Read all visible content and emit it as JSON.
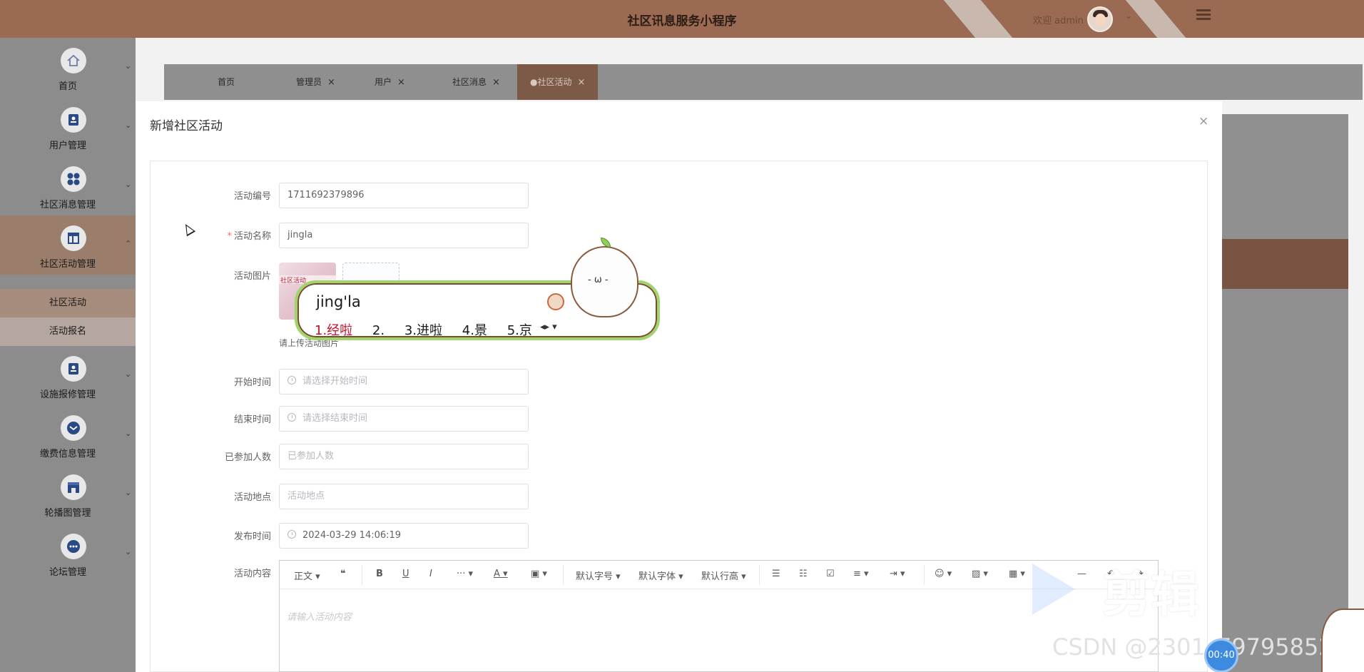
{
  "header": {
    "title": "社区讯息服务小程序",
    "welcome": "欢迎 admin"
  },
  "sidebar": {
    "items": [
      {
        "label": "首页",
        "icon": "home-icon"
      },
      {
        "label": "用户管理",
        "icon": "user-icon"
      },
      {
        "label": "社区消息管理",
        "icon": "grid-icon"
      },
      {
        "label": "社区活动管理",
        "icon": "layout-icon"
      },
      {
        "label": "设施报修管理",
        "icon": "wrench-icon"
      },
      {
        "label": "缴费信息管理",
        "icon": "mail-icon"
      },
      {
        "label": "轮播图管理",
        "icon": "store-icon"
      },
      {
        "label": "论坛管理",
        "icon": "chat-icon"
      }
    ],
    "sub_items": [
      "社区活动",
      "活动报名"
    ]
  },
  "tabs": [
    "首页",
    "管理员",
    "用户",
    "社区消息",
    "●社区活动"
  ],
  "dialog": {
    "title": "新增社区活动",
    "close": "×",
    "fields": {
      "code_label": "活动编号",
      "code_value": "1711692379896",
      "name_label": "活动名称",
      "name_required": "*",
      "name_value": "jingla",
      "image_label": "活动图片",
      "image_tip": "请上传活动图片",
      "image_thumb_text": "社区活动",
      "start_label": "开始时间",
      "start_placeholder": "请选择开始时间",
      "end_label": "结束时间",
      "end_placeholder": "请选择结束时间",
      "joined_label": "已参加人数",
      "joined_placeholder": "已参加人数",
      "place_label": "活动地点",
      "place_placeholder": "活动地点",
      "publish_label": "发布时间",
      "publish_value": "2024-03-29 14:06:19",
      "content_label": "活动内容",
      "content_placeholder": "请输入活动内容"
    },
    "editor_toolbar": {
      "paragraph": "正文",
      "font_size": "默认字号",
      "font_family": "默认字体",
      "line_height": "默认行高"
    }
  },
  "ime": {
    "typed": "jing'la",
    "candidates": [
      "1.经啦",
      "2.",
      "3.进啦",
      "4.景",
      "5.京"
    ]
  },
  "overlay_text": {
    "brand": "剪辑",
    "csdn": "CSDN @2301_79795852",
    "timer": "00:40"
  },
  "colors": {
    "header": "#9a6b52",
    "accent": "#7d5a47",
    "ime_border": "#9fd56a",
    "first_candidate": "#c8102e"
  }
}
